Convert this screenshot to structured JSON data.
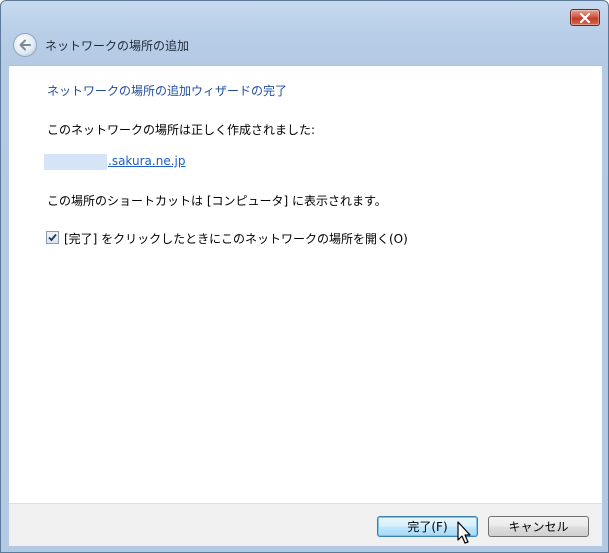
{
  "header": {
    "title": "ネットワークの場所の追加"
  },
  "content": {
    "heading": "ネットワークの場所の追加ウィザードの完了",
    "created_message": "このネットワークの場所は正しく作成されました:",
    "location_link": ".sakura.ne.jp",
    "shortcut_message": "この場所のショートカットは [コンピュータ] に表示されます。",
    "open_checkbox": {
      "label": "[完了] をクリックしたときにこのネットワークの場所を開く(O)",
      "checked": true
    }
  },
  "footer": {
    "finish_label": "完了(F)",
    "cancel_label": "キャンセル"
  },
  "icons": {
    "close": "close-icon",
    "back": "back-arrow-icon",
    "checkmark": "checkmark-icon",
    "cursor": "mouse-cursor-icon"
  },
  "colors": {
    "title_bar": "#b9cfe8",
    "heading_text": "#1e4d9c",
    "link": "#1c5ec4",
    "close_button": "#c13b2b",
    "redaction": "#d5e4f6"
  }
}
